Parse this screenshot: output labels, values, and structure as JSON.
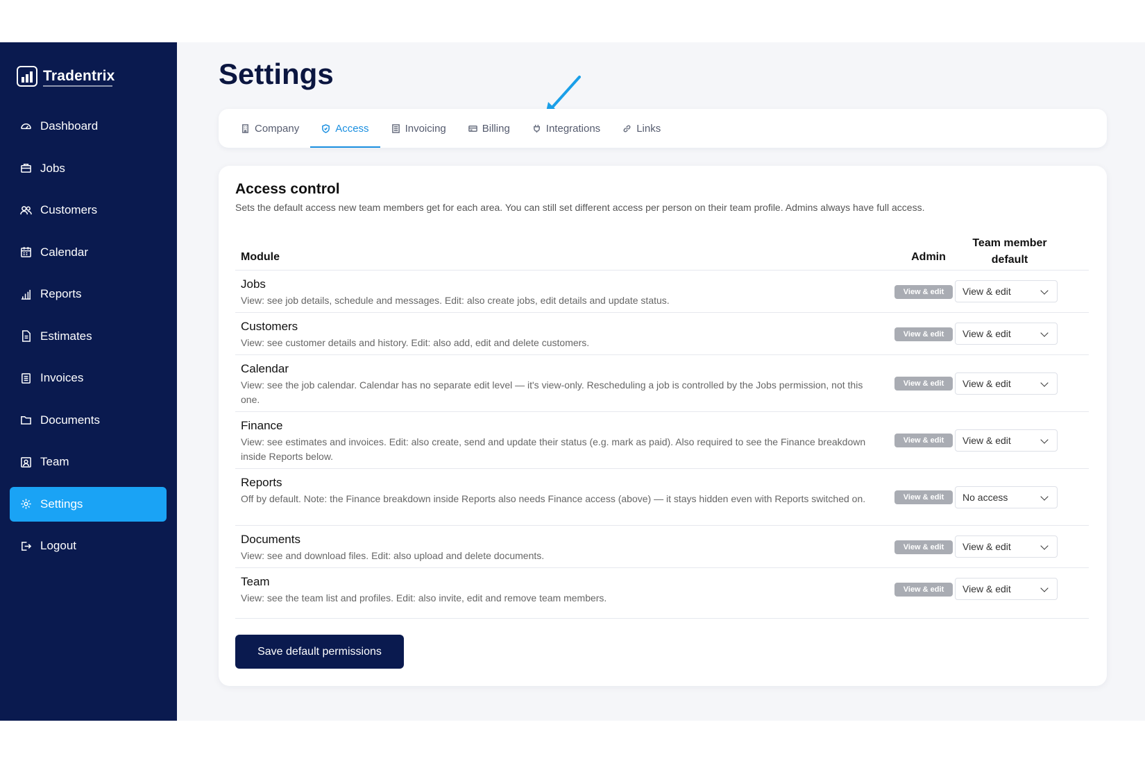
{
  "app": {
    "name": "Tradentrix"
  },
  "sidebar": {
    "items": [
      {
        "label": "Dashboard",
        "icon": "dashboard-icon"
      },
      {
        "label": "Jobs",
        "icon": "briefcase-icon"
      },
      {
        "label": "Customers",
        "icon": "users-icon"
      },
      {
        "label": "Calendar",
        "icon": "calendar-icon"
      },
      {
        "label": "Reports",
        "icon": "bar-chart-icon"
      },
      {
        "label": "Estimates",
        "icon": "file-icon"
      },
      {
        "label": "Invoices",
        "icon": "receipt-icon"
      },
      {
        "label": "Documents",
        "icon": "folder-icon"
      },
      {
        "label": "Team",
        "icon": "id-card-icon"
      },
      {
        "label": "Settings",
        "icon": "gear-icon",
        "active": true
      },
      {
        "label": "Logout",
        "icon": "logout-icon"
      }
    ]
  },
  "page": {
    "title": "Settings"
  },
  "tabs": [
    {
      "label": "Company",
      "icon": "building-icon"
    },
    {
      "label": "Access",
      "icon": "shield-icon",
      "active": true
    },
    {
      "label": "Invoicing",
      "icon": "document-icon"
    },
    {
      "label": "Billing",
      "icon": "credit-card-icon"
    },
    {
      "label": "Integrations",
      "icon": "plug-icon"
    },
    {
      "label": "Links",
      "icon": "link-icon"
    }
  ],
  "access": {
    "title": "Access control",
    "description": "Sets the default access new team members get for each area. You can still set different access per person on their team profile. Admins always have full access.",
    "columns": {
      "module": "Module",
      "admin": "Admin",
      "team_line1": "Team member",
      "team_line2": "default"
    },
    "rows": [
      {
        "name": "Jobs",
        "desc": "View: see job details, schedule and messages. Edit: also create jobs, edit details and update status.",
        "admin": "View & edit",
        "team": "View & edit"
      },
      {
        "name": "Customers",
        "desc": "View: see customer details and history. Edit: also add, edit and delete customers.",
        "admin": "View & edit",
        "team": "View & edit"
      },
      {
        "name": "Calendar",
        "desc": "View: see the job calendar. Calendar has no separate edit level — it's view-only. Rescheduling a job is controlled by the Jobs permission, not this one.",
        "admin": "View & edit",
        "team": "View & edit"
      },
      {
        "name": "Finance",
        "desc": "View: see estimates and invoices. Edit: also create, send and update their status (e.g. mark as paid). Also required to see the Finance breakdown inside Reports below.",
        "admin": "View & edit",
        "team": "View & edit"
      },
      {
        "name": "Reports",
        "desc": "Off by default. Note: the Finance breakdown inside Reports also needs Finance access (above) — it stays hidden even with Reports switched on.",
        "admin": "View & edit",
        "team": "No access"
      },
      {
        "name": "Documents",
        "desc": "View: see and download files. Edit: also upload and delete documents.",
        "admin": "View & edit",
        "team": "View & edit"
      },
      {
        "name": "Team",
        "desc": "View: see the team list and profiles. Edit: also invite, edit and remove team members.",
        "admin": "View & edit",
        "team": "View & edit"
      }
    ],
    "save_label": "Save default permissions"
  },
  "colors": {
    "sidebar_bg": "#0a1a4f",
    "accent": "#1aa3f5",
    "tab_active": "#1a8fe0",
    "badge": "#a9acb3"
  }
}
